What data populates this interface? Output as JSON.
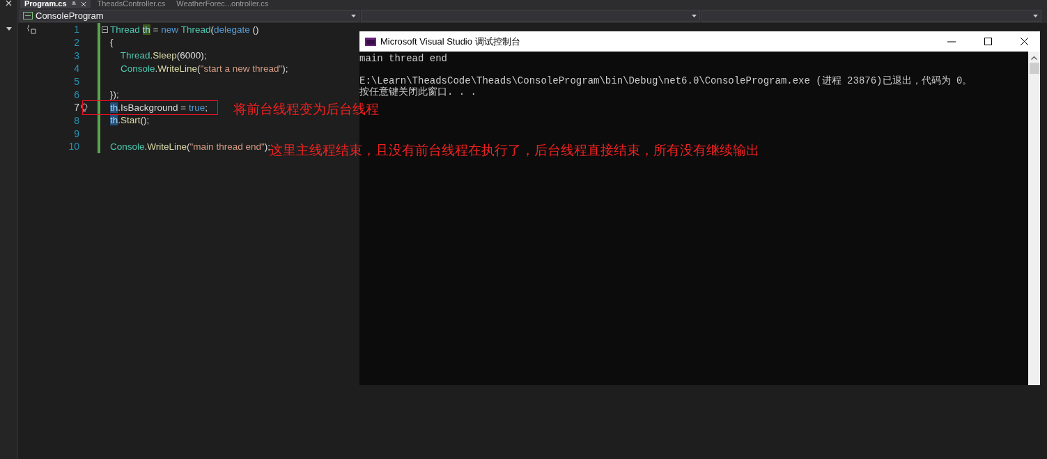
{
  "tabs": [
    {
      "label": "Program.cs",
      "selected": true
    },
    {
      "label": "TheadsController.cs",
      "selected": false
    },
    {
      "label": "WeatherForec...ontroller.cs",
      "selected": false
    }
  ],
  "nav_bar": {
    "project": "ConsoleProgram"
  },
  "code": {
    "lines": [
      {
        "number": "1",
        "current": false,
        "tokens": [
          {
            "text": "Thread ",
            "kind": "type"
          },
          {
            "text": "th",
            "kind": "ref_write"
          },
          {
            "text": " = ",
            "kind": "plain"
          },
          {
            "text": "new ",
            "kind": "keyword"
          },
          {
            "text": "Thread",
            "kind": "type"
          },
          {
            "text": "(",
            "kind": "plain"
          },
          {
            "text": "delegate",
            "kind": "keyword"
          },
          {
            "text": " ()",
            "kind": "plain"
          }
        ]
      },
      {
        "number": "2",
        "current": false,
        "tokens": [
          {
            "text": "{",
            "kind": "plain"
          }
        ]
      },
      {
        "number": "3",
        "current": false,
        "tokens": [
          {
            "text": "    Thread",
            "kind": "type"
          },
          {
            "text": ".",
            "kind": "plain"
          },
          {
            "text": "Sleep",
            "kind": "method"
          },
          {
            "text": "(6000);",
            "kind": "plain"
          }
        ]
      },
      {
        "number": "4",
        "current": false,
        "tokens": [
          {
            "text": "    Console",
            "kind": "type"
          },
          {
            "text": ".",
            "kind": "plain"
          },
          {
            "text": "WriteLine",
            "kind": "method"
          },
          {
            "text": "(",
            "kind": "plain"
          },
          {
            "text": "\"start a new thread\"",
            "kind": "string"
          },
          {
            "text": ");",
            "kind": "plain"
          }
        ]
      },
      {
        "number": "5",
        "current": false
      },
      {
        "number": "6",
        "current": false,
        "tokens": [
          {
            "text": "});",
            "kind": "plain"
          }
        ]
      },
      {
        "number": "7",
        "current": true,
        "tokens": [
          {
            "text": "th",
            "kind": "ref_read"
          },
          {
            "text": ".IsBackground = ",
            "kind": "plain"
          },
          {
            "text": "true",
            "kind": "keyword"
          },
          {
            "text": ";",
            "kind": "plain"
          }
        ]
      },
      {
        "number": "8",
        "current": false,
        "tokens": [
          {
            "text": "th",
            "kind": "ref_read"
          },
          {
            "text": ".",
            "kind": "plain"
          },
          {
            "text": "Start",
            "kind": "method"
          },
          {
            "text": "();",
            "kind": "plain"
          }
        ]
      },
      {
        "number": "9",
        "current": false
      },
      {
        "number": "10",
        "current": false,
        "tokens": [
          {
            "text": "Console",
            "kind": "type"
          },
          {
            "text": ".",
            "kind": "plain"
          },
          {
            "text": "WriteLine",
            "kind": "method"
          },
          {
            "text": "(",
            "kind": "plain"
          },
          {
            "text": "\"main thread end\"",
            "kind": "string"
          },
          {
            "text": ");",
            "kind": "plain"
          }
        ]
      }
    ]
  },
  "annotations": [
    "将前台线程变为后台线程",
    "这里主线程结束，且没有前台线程在执行了，后台线程直接结束，所有没有继续输出"
  ],
  "console_window": {
    "title": "Microsoft Visual Studio 调试控制台",
    "output": [
      "main thread end"
    ],
    "exit_message": [
      "E:\\Learn\\TheadsCode\\Theads\\ConsoleProgram\\bin\\Debug\\net6.0\\ConsoleProgram.exe (进程 23876)已退出，代码为 0。",
      "按任意键关闭此窗口. . ."
    ]
  }
}
